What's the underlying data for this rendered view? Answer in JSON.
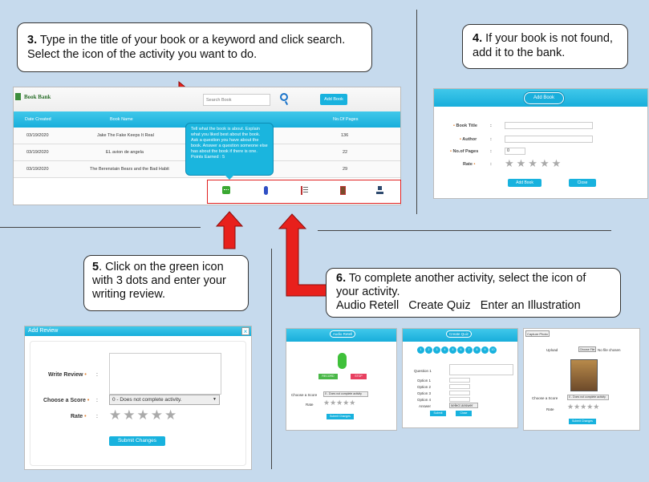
{
  "callouts": {
    "step3": {
      "num": "3.",
      "text": " Type in the title of your book or a keyword and click search. Select the icon of the activity you want to do."
    },
    "step4": {
      "num": "4.",
      "text": " If your book is not found, add it to the bank."
    },
    "step5": {
      "num": "5",
      "text": ". Click on the green icon with 3 dots and enter your writing review."
    },
    "step6": {
      "num": "6.",
      "text": " To complete another activity, select the icon of your activity.",
      "line2": "Audio Retell   Create Quiz   Enter an Illustration"
    }
  },
  "book_bank": {
    "logo": "Book Bank",
    "search_placeholder": "Search Book",
    "add_book_label": "Add Book",
    "columns": [
      "Date Created",
      "Book Name",
      "No.Of Pages"
    ],
    "rows": [
      {
        "date": "03/19/2020",
        "name": "Jake The Fake Keeps It Real",
        "pages": "136"
      },
      {
        "date": "03/19/2020",
        "name": "EL avion de angela",
        "pages": "22"
      },
      {
        "date": "03/19/2020",
        "name": "The Berenstain Bears and the Bad Habit",
        "pages": "29"
      }
    ],
    "tooltip": "Tell what the book is about. Explain what you liked best about the book. Ask a question you have about the book. Answer a question someone else has about the book if there is one.",
    "tooltip_points": "Points Earned : 5",
    "activity_icons": [
      "writing-review-icon",
      "microphone-icon",
      "quiz-list-icon",
      "illustration-icon",
      "upload-icon"
    ]
  },
  "add_book": {
    "title": "Add Book",
    "fields": [
      {
        "label": "Book Title",
        "value": ""
      },
      {
        "label": "Author",
        "value": ""
      },
      {
        "label": "No.of Pages",
        "value": "0"
      }
    ],
    "rate_label": "Rate",
    "add_button": "Add Book",
    "close_button": "Close"
  },
  "add_review": {
    "title": "Add Review",
    "close_icon": "×",
    "write_review_label": "Write Review",
    "score_label": "Choose a Score",
    "score_value": "0 - Does not complete activity.",
    "rate_label": "Rate",
    "submit_label": "Submit Changes"
  },
  "audio_retell": {
    "title": "Audio Retell",
    "record_label": "RECORD",
    "stop_label": "STOP",
    "score_label": "Choose a Score",
    "score_value": "0 - Does not complete activity",
    "rate_label": "Rate",
    "submit_label": "Submit Changes"
  },
  "create_quiz": {
    "title": "Create Quiz",
    "numbers": [
      "1",
      "2",
      "3",
      "4",
      "5",
      "6",
      "7",
      "8",
      "9",
      "10"
    ],
    "question_label": "Question 1",
    "options": [
      "Option 1",
      "Option 2",
      "Option 3",
      "Option 4"
    ],
    "answer_label": "Answer",
    "answer_value": "select answer",
    "submit_label": "Submit",
    "close_label": "Close"
  },
  "illustration": {
    "title": "Capture Photo",
    "upload_label": "Upload",
    "choose_file": "Choose File",
    "no_file": "No file chosen",
    "score_label": "Choose a Score",
    "score_value": "0 - Does not complete activity",
    "rate_label": "Rate",
    "submit_label": "Submit Changes"
  },
  "colors": {
    "accent": "#18aedb",
    "arrow": "#e8201c",
    "background": "#c6daed"
  }
}
